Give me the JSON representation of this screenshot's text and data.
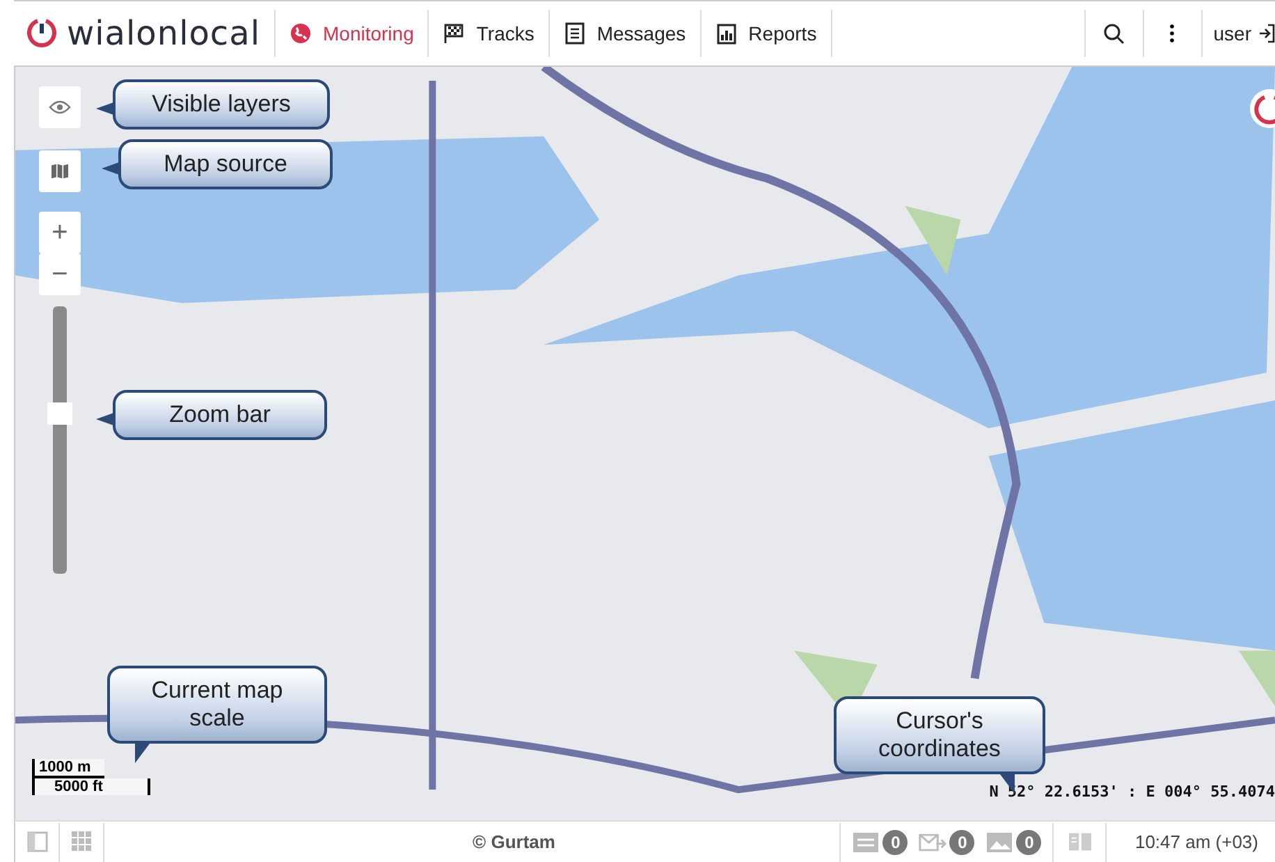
{
  "header": {
    "logo": "wialonlocal",
    "nav": [
      {
        "label": "Monitoring",
        "selected": true
      },
      {
        "label": "Tracks",
        "selected": false
      },
      {
        "label": "Messages",
        "selected": false
      },
      {
        "label": "Reports",
        "selected": false
      }
    ],
    "user": "user"
  },
  "map": {
    "zoom_in": "+",
    "zoom_out": "−",
    "zoom_bar": {
      "level": 0.6
    },
    "scale": {
      "metric": "1000 m",
      "imperial": "5000 ft"
    },
    "coordinates": "N 52° 22.6153' : E 004° 55.4074",
    "callouts": [
      {
        "text": "Visible layers"
      },
      {
        "text": "Map source"
      },
      {
        "text": "Zoom bar"
      },
      {
        "text": "Current map scale"
      },
      {
        "text": "Cursor's coordinates"
      }
    ]
  },
  "footer": {
    "copyright": "© Gurtam",
    "counters": [
      {
        "kind": "messages",
        "count": "0"
      },
      {
        "kind": "commands",
        "count": "0"
      },
      {
        "kind": "images",
        "count": "0"
      }
    ],
    "time": "10:47 am (+03)"
  }
}
